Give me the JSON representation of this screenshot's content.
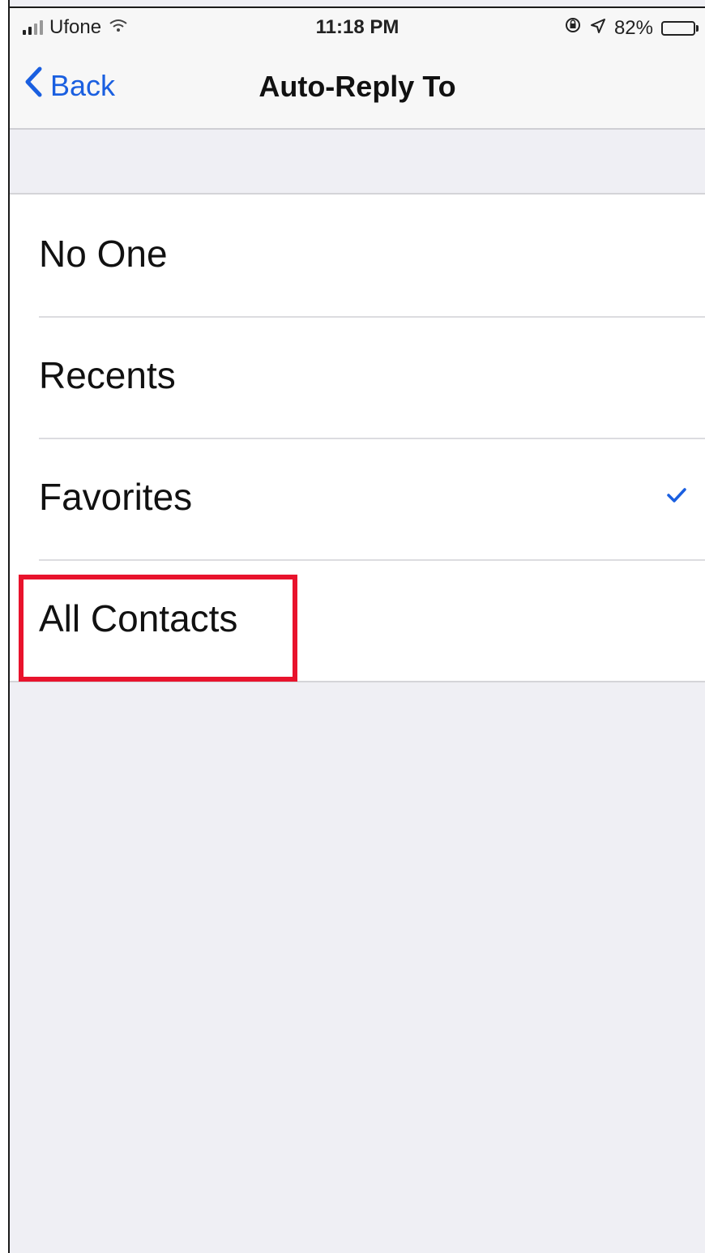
{
  "status_bar": {
    "carrier": "Ufone",
    "time": "11:18 PM",
    "battery": "82%",
    "battery_level": 0.82,
    "icons": [
      "signal-icon",
      "wifi-icon",
      "lock-rotation-icon",
      "location-icon",
      "battery-icon"
    ]
  },
  "nav": {
    "back_label": "Back",
    "title": "Auto-Reply To"
  },
  "options": [
    {
      "label": "No One",
      "selected": false
    },
    {
      "label": "Recents",
      "selected": false
    },
    {
      "label": "Favorites",
      "selected": true
    },
    {
      "label": "All Contacts",
      "selected": false
    }
  ],
  "annotation": {
    "highlighted_option": "All Contacts",
    "color": "#e8132c"
  },
  "colors": {
    "accent": "#1a5fe0",
    "background": "#efeff4",
    "cell": "#ffffff"
  }
}
